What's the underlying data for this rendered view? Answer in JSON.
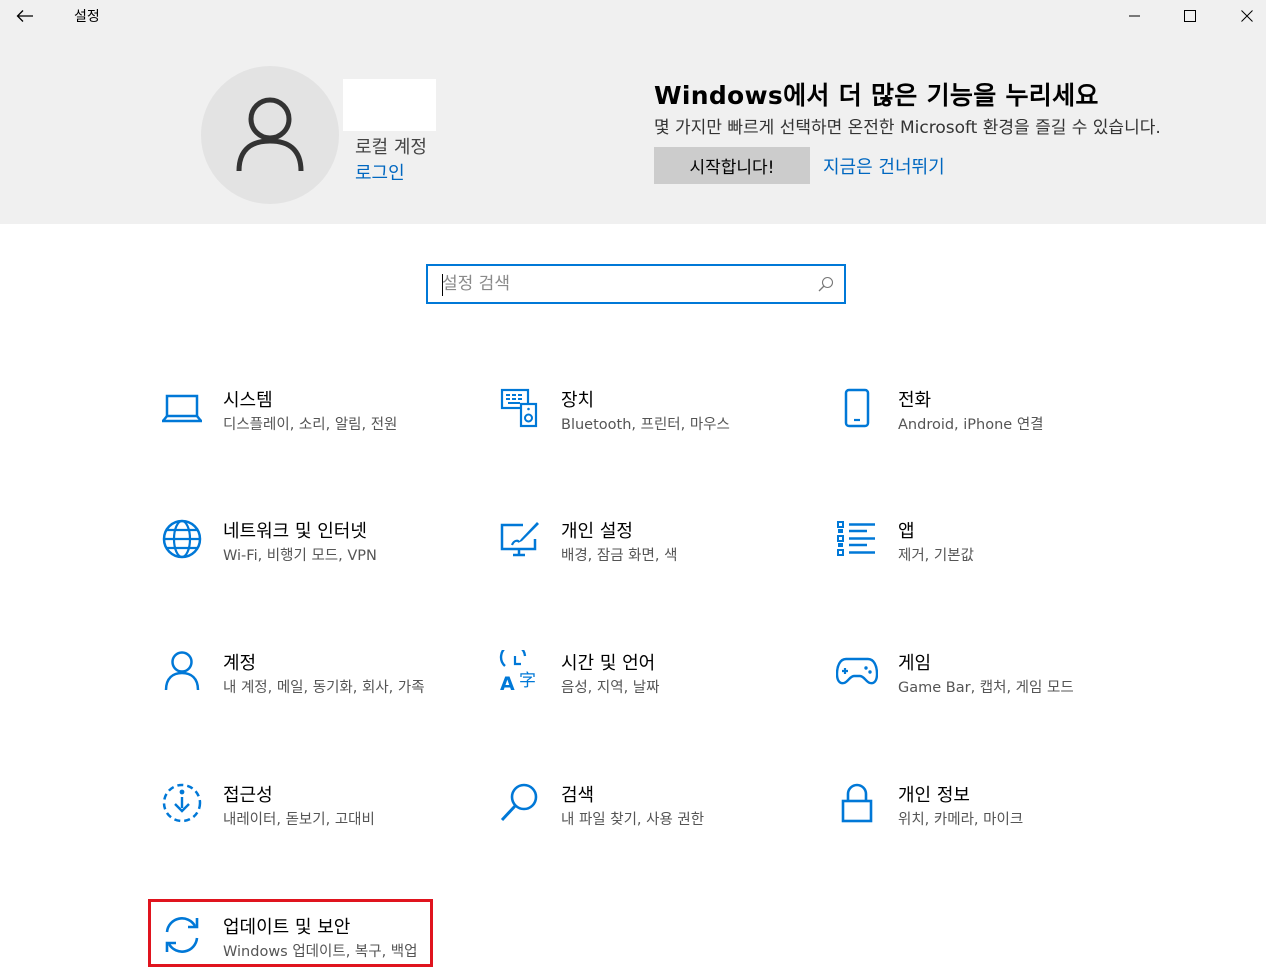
{
  "titlebar": {
    "title": "설정"
  },
  "account": {
    "type": "로컬 계정",
    "login_link": "로그인"
  },
  "promo": {
    "title": "Windows에서 더 많은 기능을 누리세요",
    "description": "몇 가지만 빠르게 선택하면 온전한 Microsoft 환경을 즐길 수 있습니다.",
    "start_button": "시작합니다!",
    "skip_link": "지금은 건너뛰기"
  },
  "search": {
    "placeholder": "설정 검색"
  },
  "accent_color": "#0078d7",
  "categories": [
    {
      "title": "시스템",
      "subtitle": "디스플레이, 소리, 알림, 전원",
      "icon": "laptop-icon"
    },
    {
      "title": "장치",
      "subtitle": "Bluetooth, 프린터, 마우스",
      "icon": "devices-icon"
    },
    {
      "title": "전화",
      "subtitle": "Android, iPhone 연결",
      "icon": "phone-icon"
    },
    {
      "title": "네트워크 및 인터넷",
      "subtitle": "Wi-Fi, 비행기 모드, VPN",
      "icon": "globe-icon"
    },
    {
      "title": "개인 설정",
      "subtitle": "배경, 잠금 화면, 색",
      "icon": "personalization-icon"
    },
    {
      "title": "앱",
      "subtitle": "제거, 기본값",
      "icon": "apps-list-icon"
    },
    {
      "title": "계정",
      "subtitle": "내 계정, 메일, 동기화, 회사, 가족",
      "icon": "person-icon"
    },
    {
      "title": "시간 및 언어",
      "subtitle": "음성, 지역, 날짜",
      "icon": "time-language-icon"
    },
    {
      "title": "게임",
      "subtitle": "Game Bar, 캡처, 게임 모드",
      "icon": "gamepad-icon"
    },
    {
      "title": "접근성",
      "subtitle": "내레이터, 돋보기, 고대비",
      "icon": "ease-of-access-icon"
    },
    {
      "title": "검색",
      "subtitle": "내 파일 찾기, 사용 권한",
      "icon": "search-magnifier-icon"
    },
    {
      "title": "개인 정보",
      "subtitle": "위치, 카메라, 마이크",
      "icon": "lock-icon"
    },
    {
      "title": "업데이트 및 보안",
      "subtitle": "Windows 업데이트, 복구, 백업",
      "icon": "sync-icon"
    }
  ]
}
